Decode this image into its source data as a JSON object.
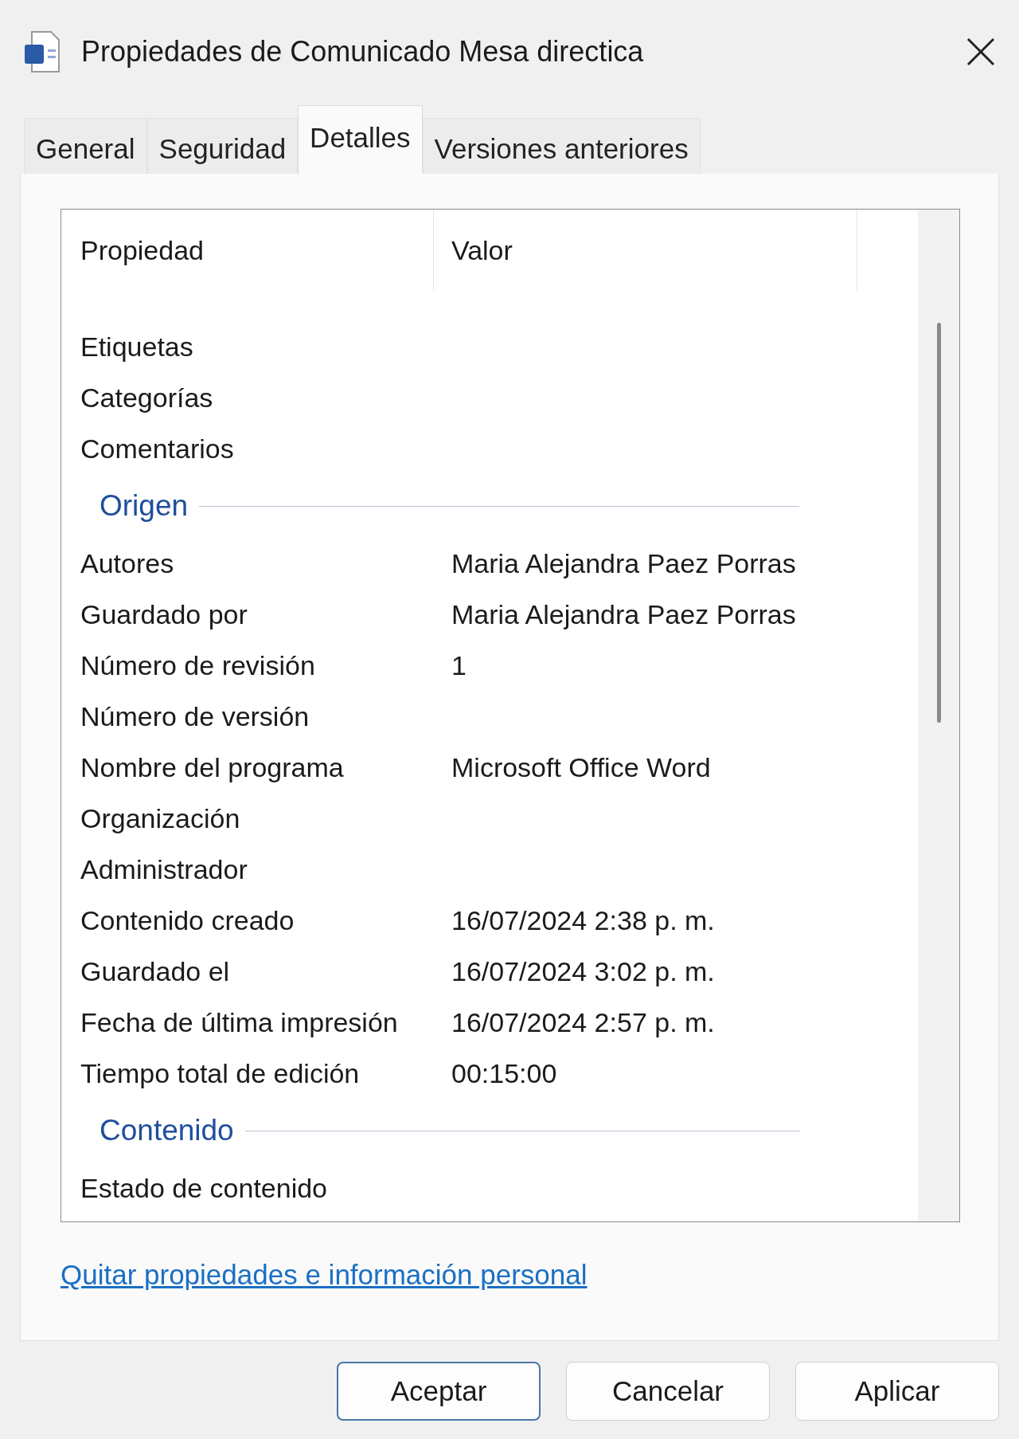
{
  "window": {
    "title": "Propiedades de Comunicado Mesa directica"
  },
  "tabs": [
    {
      "label": "General",
      "selected": false
    },
    {
      "label": "Seguridad",
      "selected": false
    },
    {
      "label": "Detalles",
      "selected": true
    },
    {
      "label": "Versiones anteriores",
      "selected": false
    }
  ],
  "details": {
    "columns": [
      "Propiedad",
      "Valor"
    ],
    "rows": [
      {
        "kind": "property",
        "name": "Etiquetas"
      },
      {
        "kind": "property",
        "name": "Categorías"
      },
      {
        "kind": "property",
        "name": "Comentarios"
      },
      {
        "kind": "group",
        "name": "Origen"
      },
      {
        "kind": "property",
        "name": "Autores",
        "value": "Maria Alejandra Paez Porras"
      },
      {
        "kind": "property",
        "name": "Guardado por",
        "value": "Maria Alejandra Paez Porras"
      },
      {
        "kind": "property",
        "name": "Número de revisión",
        "value": "1"
      },
      {
        "kind": "property",
        "name": "Número de versión"
      },
      {
        "kind": "property",
        "name": "Nombre del programa",
        "value": "Microsoft Office Word"
      },
      {
        "kind": "property",
        "name": "Organización"
      },
      {
        "kind": "property",
        "name": "Administrador"
      },
      {
        "kind": "property",
        "name": "Contenido creado",
        "value": "16/07/2024 2:38 p. m."
      },
      {
        "kind": "property",
        "name": "Guardado el",
        "value": "16/07/2024 3:02 p. m."
      },
      {
        "kind": "property",
        "name": "Fecha de última impresión",
        "value": "16/07/2024 2:57 p. m."
      },
      {
        "kind": "property",
        "name": "Tiempo total de edición",
        "value": "00:15:00"
      },
      {
        "kind": "group",
        "name": "Contenido"
      },
      {
        "kind": "property",
        "name": "Estado de contenido"
      }
    ]
  },
  "link": "Quitar propiedades e información personal",
  "buttons": [
    {
      "label": "Aceptar",
      "default": true
    },
    {
      "label": "Cancelar",
      "default": false
    },
    {
      "label": "Aplicar",
      "default": false
    }
  ]
}
